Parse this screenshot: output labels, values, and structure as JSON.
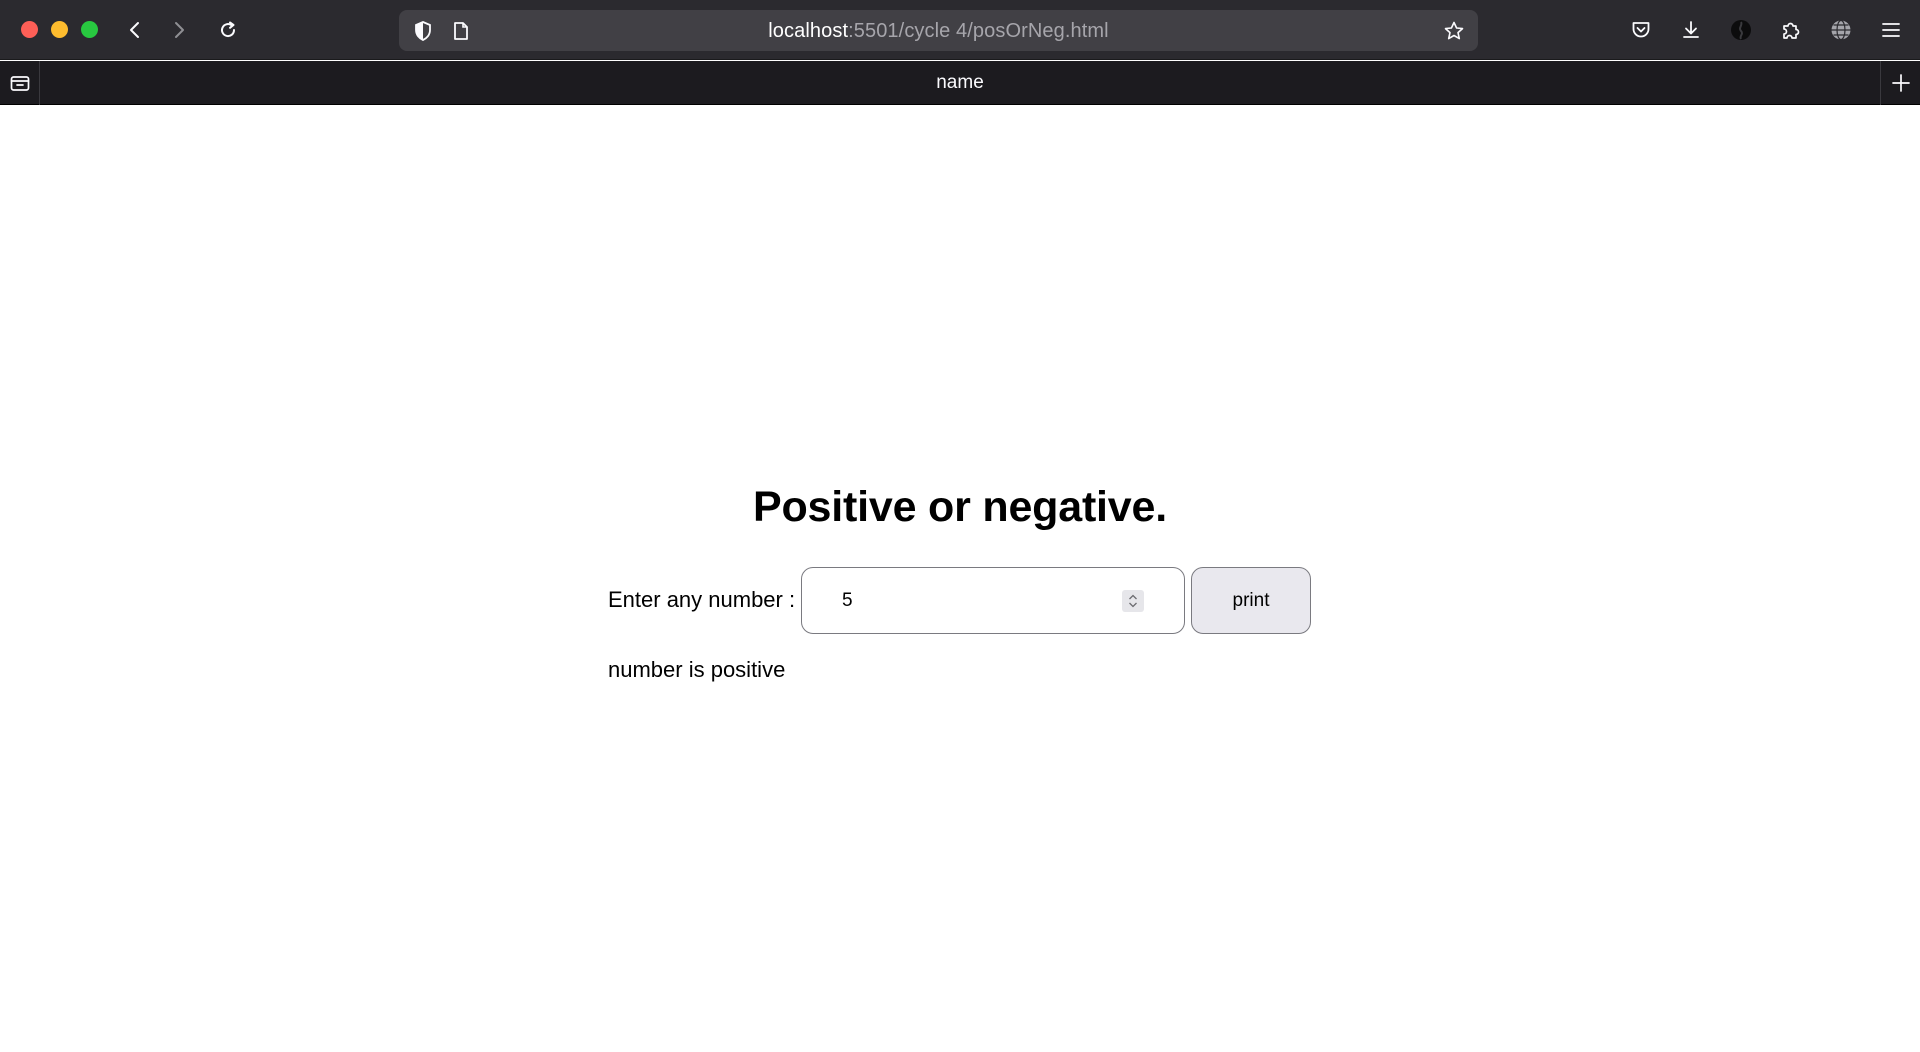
{
  "browser": {
    "url_host": "localhost",
    "url_path": ":5501/cycle 4/posOrNeg.html",
    "tab_title": "name",
    "icons": {
      "back": "back-arrow-icon",
      "forward": "forward-arrow-icon",
      "reload": "reload-icon",
      "shield": "tracking-shield-icon",
      "page": "page-icon",
      "bookmark": "bookmark-star-icon",
      "pocket": "pocket-icon",
      "download": "download-icon",
      "profile": "profile-icon",
      "extensions": "extensions-icon",
      "globe": "globe-icon",
      "menu": "hamburger-menu-icon",
      "tab_list": "tab-list-icon",
      "new_tab": "new-tab-plus-icon"
    }
  },
  "page": {
    "heading": "Positive or negative.",
    "input_label": "Enter any number :",
    "input_value": "5",
    "button_label": "print",
    "result_text": "number is positive"
  },
  "colors": {
    "titlebar": "#2b2a2f",
    "urlbar": "#414045",
    "tabbar": "#1c1b1f",
    "button_bg": "#e9e8ee"
  }
}
